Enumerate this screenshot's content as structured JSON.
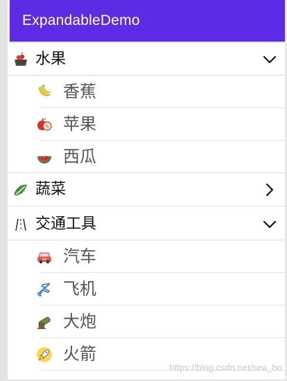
{
  "app": {
    "title": "ExpandableDemo"
  },
  "groups": [
    {
      "label": "水果",
      "expanded": true,
      "icon": "fruit-basket-icon",
      "children": [
        {
          "label": "香蕉",
          "icon": "banana-icon"
        },
        {
          "label": "苹果",
          "icon": "apple-icon"
        },
        {
          "label": "西瓜",
          "icon": "watermelon-icon"
        }
      ]
    },
    {
      "label": "蔬菜",
      "expanded": false,
      "icon": "vegetable-icon",
      "children": []
    },
    {
      "label": "交通工具",
      "expanded": true,
      "icon": "road-icon",
      "children": [
        {
          "label": "汽车",
          "icon": "car-icon"
        },
        {
          "label": "飞机",
          "icon": "airplane-icon"
        },
        {
          "label": "大炮",
          "icon": "cannon-icon"
        },
        {
          "label": "火箭",
          "icon": "rocket-icon"
        }
      ]
    }
  ],
  "watermark": "https://blog.csdn.net/sea_bo",
  "colors": {
    "appbar": "#5c2be4",
    "child_text": "#555555",
    "group_text": "#111111"
  }
}
